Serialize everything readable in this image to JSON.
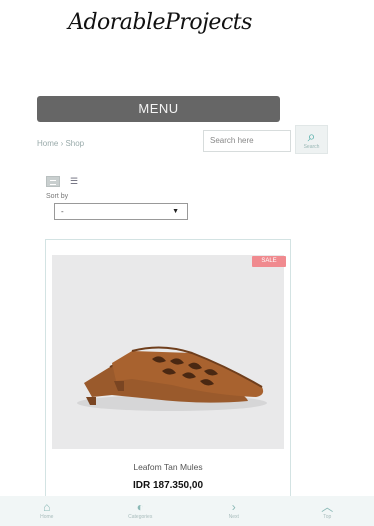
{
  "header": {
    "logo_text": "AdorableProjects"
  },
  "menu": {
    "label": "MENU"
  },
  "breadcrumb": {
    "text": "Home › Shop"
  },
  "search": {
    "placeholder": "Search here",
    "button_label": "Search"
  },
  "view": {
    "list_icon": "☰"
  },
  "sort": {
    "label": "Sort by",
    "selected": "-"
  },
  "product": {
    "badge": "SALE",
    "name": "Leafom Tan Mules",
    "price": "IDR 187.350,00"
  },
  "bottom_nav": {
    "items": [
      {
        "icon": "home-icon",
        "label": "Home"
      },
      {
        "icon": "categories-icon",
        "label": "Categories"
      },
      {
        "icon": "next-icon",
        "label": "Next"
      },
      {
        "icon": "top-icon",
        "label": "Top"
      }
    ]
  },
  "colors": {
    "menu_bg": "#666666",
    "accent": "#49a9a4",
    "sale": "#f08a8f",
    "image_bg": "#e9e9ea"
  }
}
